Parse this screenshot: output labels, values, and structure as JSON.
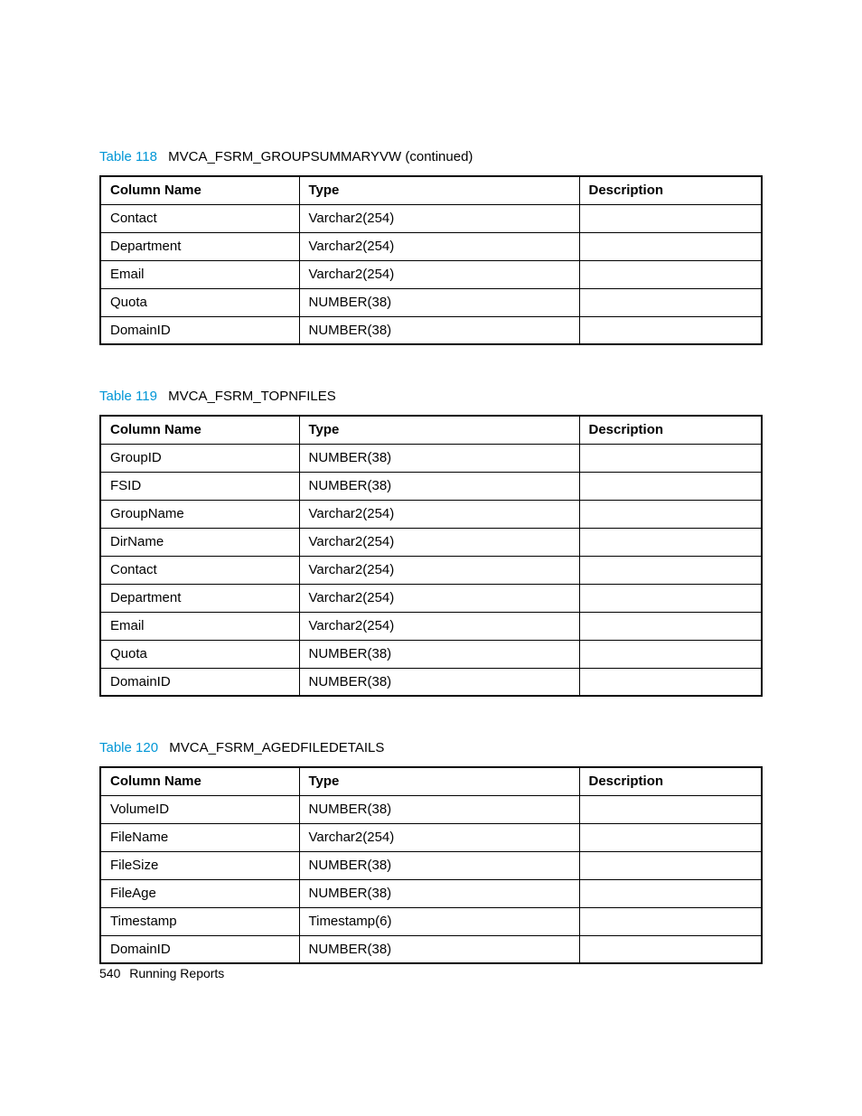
{
  "tables": [
    {
      "label": "Table 118",
      "name": "MVCA_FSRM_GROUPSUMMARYVW (continued)",
      "headers": [
        "Column Name",
        "Type",
        "Description"
      ],
      "rows": [
        {
          "col": "Contact",
          "type": "Varchar2(254)",
          "desc": ""
        },
        {
          "col": "Department",
          "type": "Varchar2(254)",
          "desc": ""
        },
        {
          "col": "Email",
          "type": "Varchar2(254)",
          "desc": ""
        },
        {
          "col": "Quota",
          "type": "NUMBER(38)",
          "desc": ""
        },
        {
          "col": "DomainID",
          "type": "NUMBER(38)",
          "desc": ""
        }
      ]
    },
    {
      "label": "Table 119",
      "name": "MVCA_FSRM_TOPNFILES",
      "headers": [
        "Column Name",
        "Type",
        "Description"
      ],
      "rows": [
        {
          "col": "GroupID",
          "type": "NUMBER(38)",
          "desc": ""
        },
        {
          "col": "FSID",
          "type": "NUMBER(38)",
          "desc": ""
        },
        {
          "col": "GroupName",
          "type": "Varchar2(254)",
          "desc": ""
        },
        {
          "col": "DirName",
          "type": "Varchar2(254)",
          "desc": ""
        },
        {
          "col": "Contact",
          "type": "Varchar2(254)",
          "desc": ""
        },
        {
          "col": "Department",
          "type": "Varchar2(254)",
          "desc": ""
        },
        {
          "col": "Email",
          "type": "Varchar2(254)",
          "desc": ""
        },
        {
          "col": "Quota",
          "type": "NUMBER(38)",
          "desc": ""
        },
        {
          "col": "DomainID",
          "type": "NUMBER(38)",
          "desc": ""
        }
      ]
    },
    {
      "label": "Table 120",
      "name": "MVCA_FSRM_AGEDFILEDETAILS",
      "headers": [
        "Column Name",
        "Type",
        "Description"
      ],
      "rows": [
        {
          "col": "VolumeID",
          "type": "NUMBER(38)",
          "desc": ""
        },
        {
          "col": "FileName",
          "type": "Varchar2(254)",
          "desc": ""
        },
        {
          "col": "FileSize",
          "type": "NUMBER(38)",
          "desc": ""
        },
        {
          "col": "FileAge",
          "type": "NUMBER(38)",
          "desc": ""
        },
        {
          "col": "Timestamp",
          "type": "Timestamp(6)",
          "desc": ""
        },
        {
          "col": "DomainID",
          "type": "NUMBER(38)",
          "desc": ""
        }
      ]
    }
  ],
  "footer": {
    "page": "540",
    "section": "Running Reports"
  }
}
